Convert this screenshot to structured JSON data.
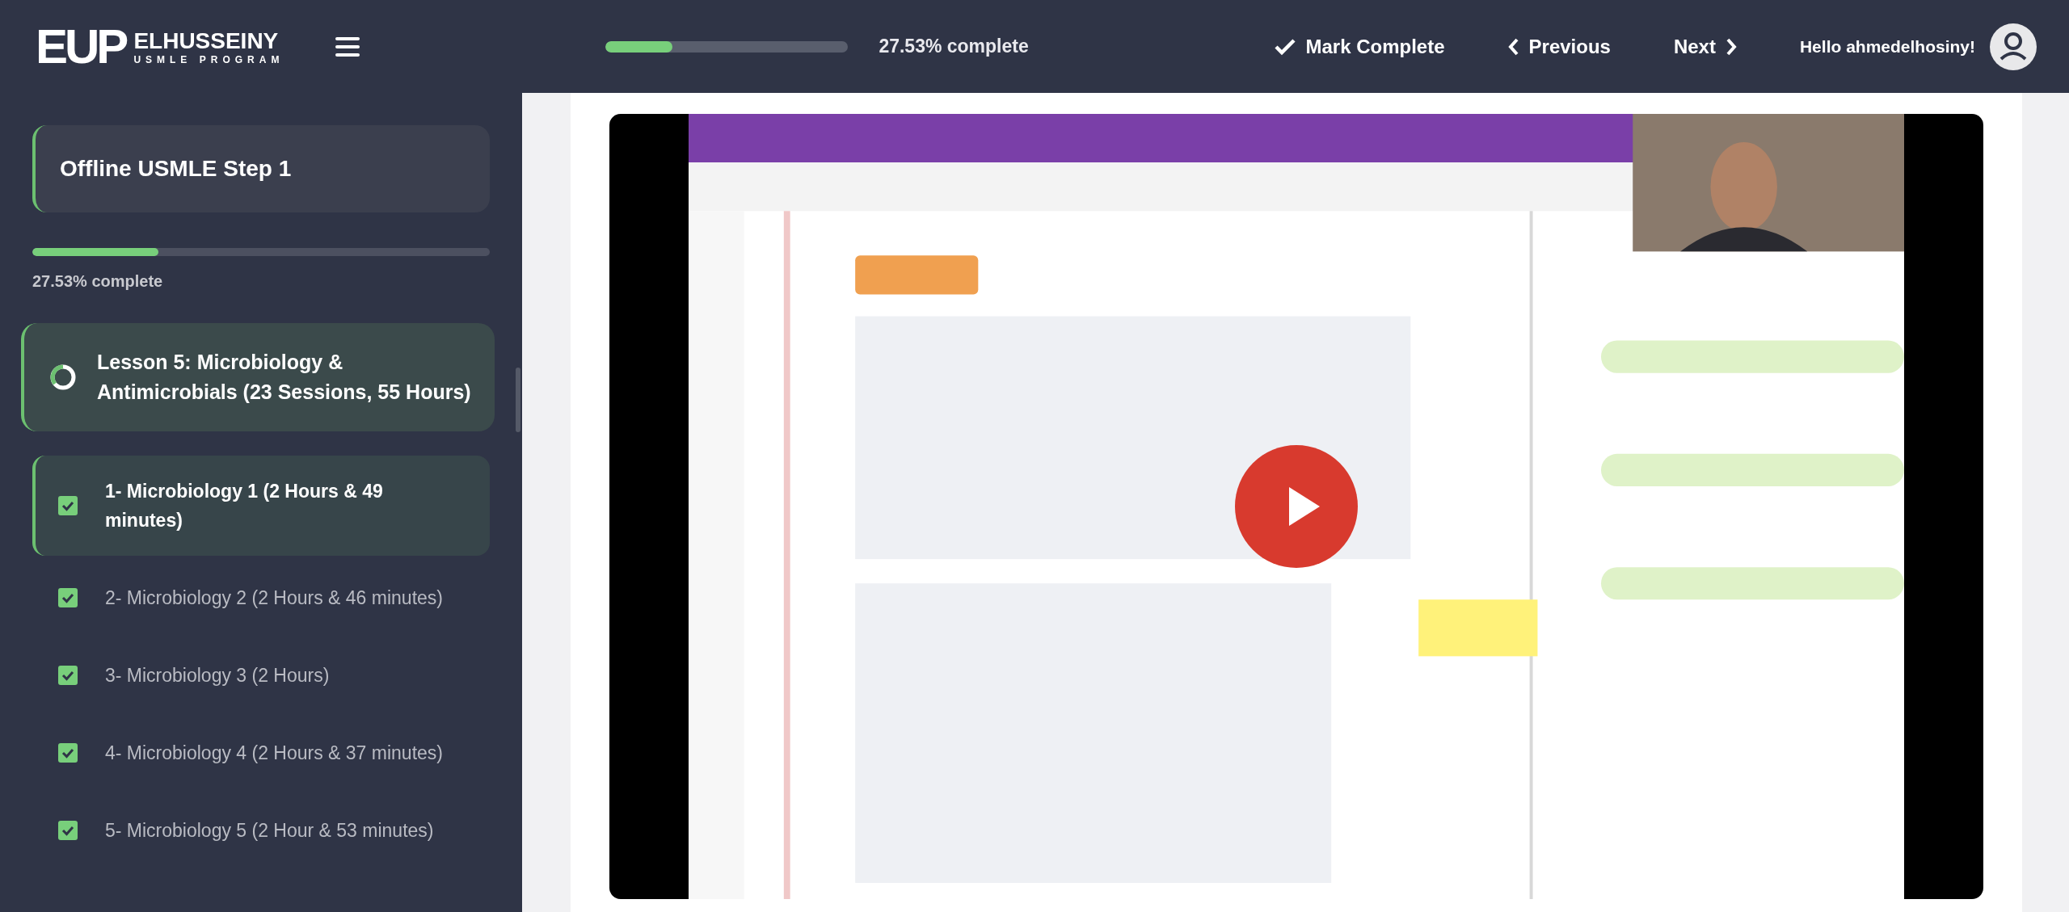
{
  "header": {
    "logo_mark": "EUP",
    "logo_name": "ELHUSSEINY",
    "logo_tagline": "USMLE PROGRAM",
    "progress": {
      "level": 0.2753,
      "label": "27.53% complete"
    },
    "mark_complete": "Mark Complete",
    "previous": "Previous",
    "next": "Next",
    "greeting": "Hello ahmedelhosiny!"
  },
  "sidebar": {
    "course_title": "Offline USMLE Step 1",
    "progress": {
      "level": 0.2753,
      "label": "27.53% complete"
    },
    "lesson": {
      "title": "Lesson 5: Microbiology & Antimicrobials (23 Sessions, 55 Hours)",
      "expanded": true
    },
    "items": [
      {
        "label": "1- Microbiology 1 (2 Hours & 49 minutes)",
        "checked": true,
        "selected": true
      },
      {
        "label": "2- Microbiology 2 (2 Hours & 46 minutes)",
        "checked": true,
        "selected": false
      },
      {
        "label": "3- Microbiology 3 (2 Hours)",
        "checked": true,
        "selected": false
      },
      {
        "label": "4- Microbiology 4 (2 Hours & 37 minutes)",
        "checked": true,
        "selected": false
      },
      {
        "label": "5- Microbiology 5 (2 Hour & 53 minutes)",
        "checked": true,
        "selected": false
      }
    ]
  },
  "video": {
    "playing": false
  }
}
